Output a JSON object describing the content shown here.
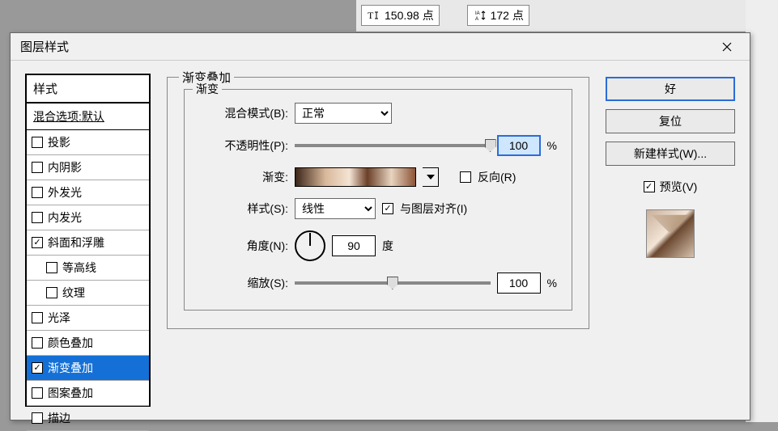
{
  "background": {
    "fontsize_value": "150.98 点",
    "leading_value": "172 点"
  },
  "dialog": {
    "title": "图层样式",
    "styles_panel": {
      "header": "样式",
      "subheader": "混合选项:默认",
      "items": [
        {
          "label": "投影",
          "checked": false,
          "indent": false
        },
        {
          "label": "内阴影",
          "checked": false,
          "indent": false
        },
        {
          "label": "外发光",
          "checked": false,
          "indent": false
        },
        {
          "label": "内发光",
          "checked": false,
          "indent": false
        },
        {
          "label": "斜面和浮雕",
          "checked": true,
          "indent": false
        },
        {
          "label": "等高线",
          "checked": false,
          "indent": true
        },
        {
          "label": "纹理",
          "checked": false,
          "indent": true
        },
        {
          "label": "光泽",
          "checked": false,
          "indent": false
        },
        {
          "label": "颜色叠加",
          "checked": false,
          "indent": false
        },
        {
          "label": "渐变叠加",
          "checked": true,
          "indent": false,
          "selected": true
        },
        {
          "label": "图案叠加",
          "checked": false,
          "indent": false
        },
        {
          "label": "描边",
          "checked": false,
          "indent": false
        }
      ]
    },
    "center": {
      "group_title": "渐变叠加",
      "inner_title": "渐变",
      "blend_mode_label": "混合模式(B):",
      "blend_mode_value": "正常",
      "opacity_label": "不透明性(P):",
      "opacity_value": "100",
      "percent": "%",
      "gradient_label": "渐变:",
      "reverse_label": "反向(R)",
      "reverse_checked": false,
      "style_label": "样式(S):",
      "style_value": "线性",
      "align_label": "与图层对齐(I)",
      "align_checked": true,
      "angle_label": "角度(N):",
      "angle_value": "90",
      "degree": "度",
      "scale_label": "缩放(S):",
      "scale_value": "100"
    },
    "right": {
      "ok": "好",
      "reset": "复位",
      "new_style": "新建样式(W)...",
      "preview_label": "预览(V)",
      "preview_checked": true
    }
  }
}
